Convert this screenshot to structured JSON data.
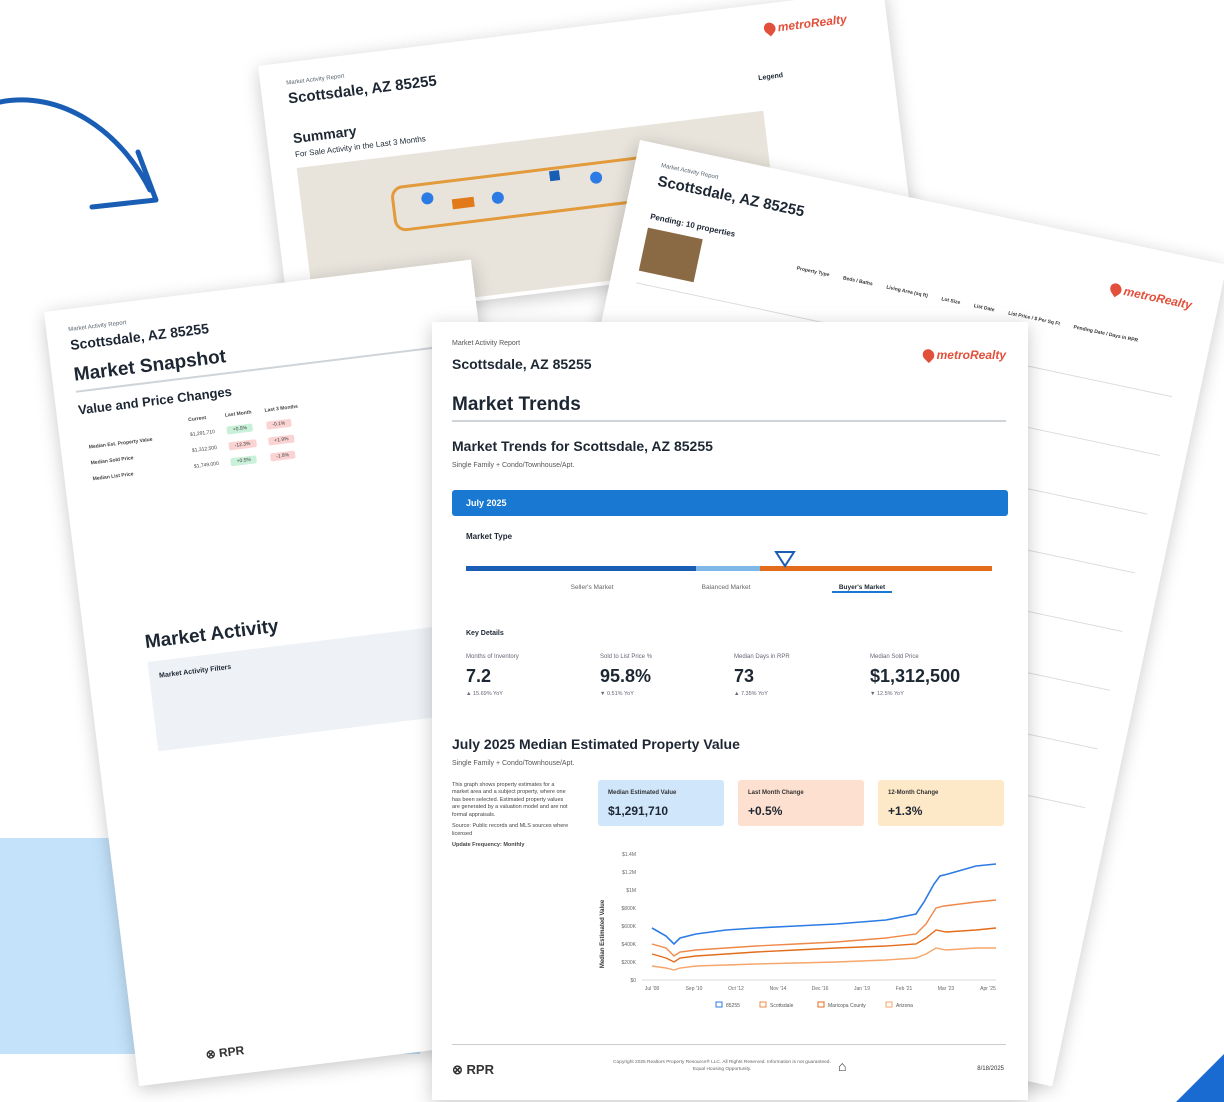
{
  "colors": {
    "brand_red": "#e2503b",
    "accent_blue": "#1979d2",
    "orange": "#e36c1a",
    "light_blue_bg": "#c4e3fb"
  },
  "logo_text": "metroRealty",
  "rpr_label": "RPR",
  "s1": {
    "report": "Market Activity Report",
    "city": "Scottsdale, AZ 85255",
    "section": "Summary",
    "subtitle": "For Sale Activity in the Last 3 Months",
    "legend": "Legend"
  },
  "s2": {
    "report": "Market Activity Report",
    "city": "Scottsdale, AZ 85255",
    "pending": "Pending: 10 properties",
    "cols": [
      "Property Type",
      "Beds / Baths",
      "Living Area (sq ft)",
      "Lot Size",
      "List Date",
      "List Price / $ Per Sq Ft",
      "Pending Date / Days in RPR"
    ]
  },
  "s3": {
    "report": "Market Activity Report",
    "city": "Scottsdale, AZ 85255",
    "section": "Market Snapshot",
    "sub": "Value and Price Changes",
    "cols": [
      "Current",
      "Last Month",
      "Last 3 Months"
    ],
    "rows": [
      {
        "name": "Median Est. Property Value",
        "cur": "$1,291,710",
        "lm": "+0.5%",
        "l3": "-0.1%"
      },
      {
        "name": "Median Sold Price",
        "cur": "$1,312,500",
        "lm": "-12.3%",
        "l3": "+1.9%"
      },
      {
        "name": "Median List Price",
        "cur": "$1,749,000",
        "lm": "+0.5%",
        "l3": "-1.8%"
      }
    ],
    "activity": "Market Activity",
    "filters": "Market Activity Filters"
  },
  "s4": {
    "report": "Market Activity Report",
    "city": "Scottsdale, AZ 85255",
    "section": "Market Trends",
    "heading": "Market Trends for Scottsdale, AZ 85255",
    "ptype": "Single Family + Condo/Townhouse/Apt.",
    "month": "July 2025",
    "market_type": "Market Type",
    "markets": [
      "Seller's Market",
      "Balanced Market",
      "Buyer's Market"
    ],
    "key_details": "Key Details",
    "kd": [
      {
        "label": "Months of Inventory",
        "value": "7.2",
        "chg": "▲ 15.69% YoY"
      },
      {
        "label": "Sold to List Price %",
        "value": "95.8%",
        "chg": "▼ 0.51% YoY"
      },
      {
        "label": "Median Days in RPR",
        "value": "73",
        "chg": "▲ 7.35% YoY"
      },
      {
        "label": "Median Sold Price",
        "value": "$1,312,500",
        "chg": "▼ 12.5% YoY"
      }
    ],
    "median_title": "July 2025 Median Estimated Property Value",
    "ptype2": "Single Family + Condo/Townhouse/Apt.",
    "desc": "This graph shows property estimates for a market area and a subject property, where one has been selected. Estimated property values are generated by a valuation model and are not formal appraisals.",
    "source": "Source: Public records and MLS sources where licensed",
    "update": "Update Frequency: Monthly",
    "boxes": [
      {
        "label": "Median Estimated Value",
        "value": "$1,291,710"
      },
      {
        "label": "Last Month Change",
        "value": "+0.5%"
      },
      {
        "label": "12-Month Change",
        "value": "+1.3%"
      }
    ],
    "ylabel": "Median Estimated Value",
    "yticks": [
      "$1.4M",
      "$1.2M",
      "$1M",
      "$800K",
      "$600K",
      "$400K",
      "$200K",
      "$0"
    ],
    "xticks": [
      "Jul '08",
      "Sep '10",
      "Oct '12",
      "Nov '14",
      "Dec '16",
      "Jan '19",
      "Feb '21",
      "Mar '23",
      "Apr '25"
    ],
    "legend": [
      "85255",
      "Scottsdale",
      "Maricopa County",
      "Arizona"
    ],
    "footer": "Copyright 2025 Realtors Property Resource® LLC. All Rights Reserved. Information is not guaranteed. Equal Housing Opportunity.",
    "date": "8/18/2025"
  }
}
